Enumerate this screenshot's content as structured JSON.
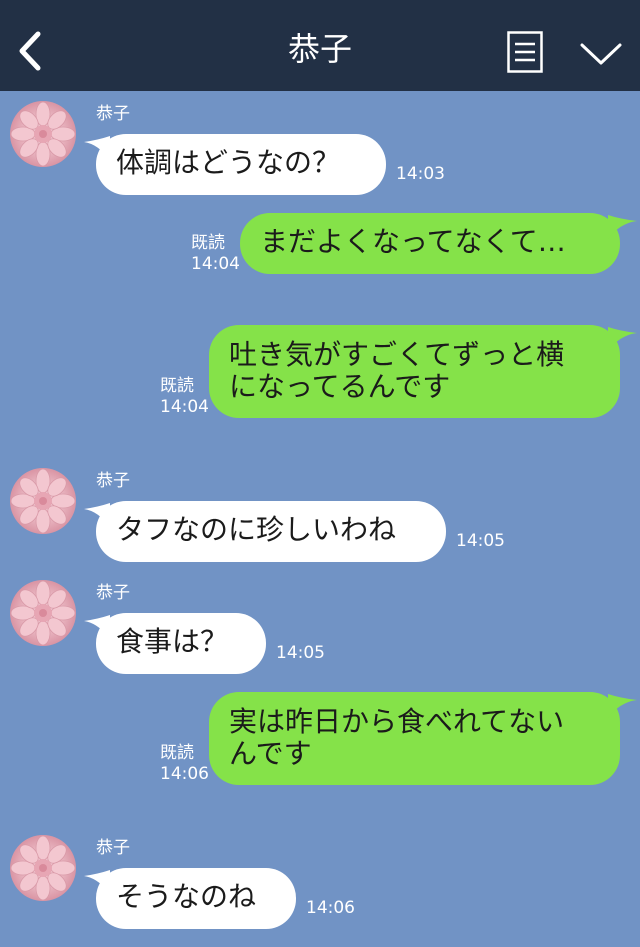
{
  "header": {
    "title": "恭子"
  },
  "messages": [
    {
      "side": "in",
      "sender": "恭子",
      "text": "体調はどうなの？",
      "time": "14:03"
    },
    {
      "side": "out",
      "read": "既読",
      "text": "まだよくなってなくて…",
      "time": "14:04"
    },
    {
      "side": "out",
      "read": "既読",
      "lines": [
        "吐き気がすごくてずっと横",
        "になってるんです"
      ],
      "time": "14:04"
    },
    {
      "side": "in",
      "sender": "恭子",
      "text": "タフなのに珍しいわね",
      "time": "14:05"
    },
    {
      "side": "in",
      "sender": "恭子",
      "text": "食事は？",
      "time": "14:05"
    },
    {
      "side": "out",
      "read": "既読",
      "lines": [
        "実は昨日から食べれてない",
        "んです"
      ],
      "time": "14:06"
    },
    {
      "side": "in",
      "sender": "恭子",
      "text": "そうなのね",
      "time": "14:06"
    }
  ],
  "colors": {
    "header": "#223045",
    "background": "#7193c5",
    "outgoing_bubble": "#85e249",
    "incoming_bubble": "#ffffff"
  },
  "icons": {
    "back": "chevron-left-icon",
    "notes": "notes-icon",
    "menu": "chevron-down-icon",
    "avatar": "flower-avatar"
  }
}
